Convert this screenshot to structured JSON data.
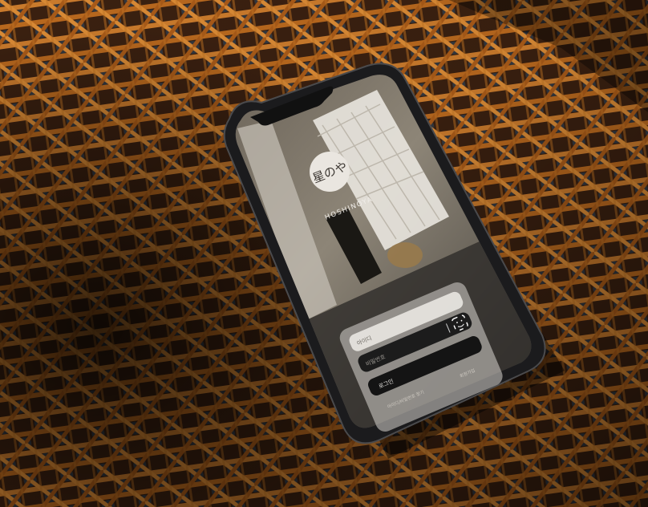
{
  "app": {
    "logo_glyphs": "星のや",
    "brand_name": "HOSHINOYA"
  },
  "login": {
    "id_field_label": "아이디",
    "password_field_label": "비밀번호",
    "login_button_label": "로그인",
    "find_account_link": "아이디/비밀번호 찾기",
    "signup_link": "회원가입"
  },
  "colors": {
    "rattan": "#c9782a",
    "rattan_dark": "#7a3d10",
    "shadow": "#120a05",
    "phone_frame": "#1b1b1d",
    "logo_circle": "#eae6e0",
    "card_bg": "#d9d6d0",
    "button_bg": "#141414"
  },
  "icons": {
    "face_id": "face-id-icon"
  }
}
